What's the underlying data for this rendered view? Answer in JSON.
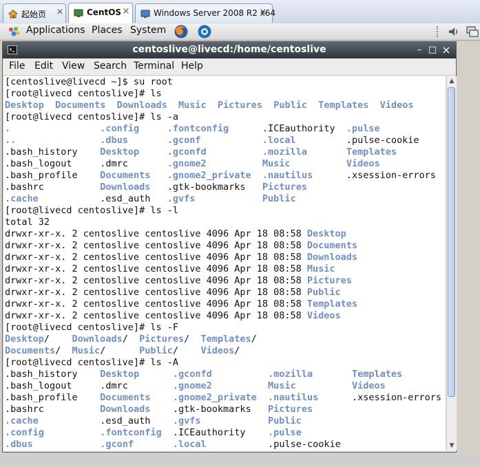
{
  "tabs": [
    {
      "label": "起始页",
      "icon": "home-icon",
      "active": false
    },
    {
      "label": "CentOS",
      "icon": "vm-icon",
      "active": true
    },
    {
      "label": "Windows Server 2008 R2 x64",
      "icon": "vm-icon",
      "active": false
    }
  ],
  "panel": {
    "applications": "Applications",
    "places": "Places",
    "system": "System"
  },
  "window": {
    "title": "centoslive@livecd:/home/centoslive",
    "minimize": "–",
    "maximize": "□",
    "close": "×"
  },
  "menu": {
    "file": "File",
    "edit": "Edit",
    "view": "View",
    "search": "Search",
    "terminal": "Terminal",
    "help": "Help"
  },
  "terminal": {
    "lines": [
      [
        [
          "n",
          "[centoslive@livecd ~]$ su root"
        ]
      ],
      [
        [
          "n",
          "[root@livecd centoslive]# ls"
        ]
      ],
      [
        [
          "d",
          "Desktop"
        ],
        [
          "n",
          "  "
        ],
        [
          "d",
          "Documents"
        ],
        [
          "n",
          "  "
        ],
        [
          "d",
          "Downloads"
        ],
        [
          "n",
          "  "
        ],
        [
          "d",
          "Music"
        ],
        [
          "n",
          "  "
        ],
        [
          "d",
          "Pictures"
        ],
        [
          "n",
          "  "
        ],
        [
          "d",
          "Public"
        ],
        [
          "n",
          "  "
        ],
        [
          "d",
          "Templates"
        ],
        [
          "n",
          "  "
        ],
        [
          "d",
          "Videos"
        ]
      ],
      [
        [
          "n",
          "[root@livecd centoslive]# ls -a"
        ]
      ],
      [
        [
          "d",
          "."
        ],
        [
          "n",
          "                "
        ],
        [
          "d",
          ".config"
        ],
        [
          "n",
          "     "
        ],
        [
          "d",
          ".fontconfig"
        ],
        [
          "n",
          "      "
        ],
        [
          "n",
          ".ICEauthority"
        ],
        [
          "n",
          "  "
        ],
        [
          "d",
          ".pulse"
        ]
      ],
      [
        [
          "d",
          ".."
        ],
        [
          "n",
          "               "
        ],
        [
          "d",
          ".dbus"
        ],
        [
          "n",
          "       "
        ],
        [
          "d",
          ".gconf"
        ],
        [
          "n",
          "           "
        ],
        [
          "d",
          ".local"
        ],
        [
          "n",
          "         "
        ],
        [
          "n",
          ".pulse-cookie"
        ]
      ],
      [
        [
          "n",
          ".bash_history"
        ],
        [
          "n",
          "    "
        ],
        [
          "d",
          "Desktop"
        ],
        [
          "n",
          "     "
        ],
        [
          "d",
          ".gconfd"
        ],
        [
          "n",
          "          "
        ],
        [
          "d",
          ".mozilla"
        ],
        [
          "n",
          "       "
        ],
        [
          "d",
          "Templates"
        ]
      ],
      [
        [
          "n",
          ".bash_logout"
        ],
        [
          "n",
          "     "
        ],
        [
          "n",
          ".dmrc"
        ],
        [
          "n",
          "       "
        ],
        [
          "d",
          ".gnome2"
        ],
        [
          "n",
          "          "
        ],
        [
          "d",
          "Music"
        ],
        [
          "n",
          "          "
        ],
        [
          "d",
          "Videos"
        ]
      ],
      [
        [
          "n",
          ".bash_profile"
        ],
        [
          "n",
          "    "
        ],
        [
          "d",
          "Documents"
        ],
        [
          "n",
          "   "
        ],
        [
          "d",
          ".gnome2_private"
        ],
        [
          "n",
          "  "
        ],
        [
          "d",
          ".nautilus"
        ],
        [
          "n",
          "      "
        ],
        [
          "n",
          ".xsession-errors"
        ]
      ],
      [
        [
          "n",
          ".bashrc"
        ],
        [
          "n",
          "          "
        ],
        [
          "d",
          "Downloads"
        ],
        [
          "n",
          "   "
        ],
        [
          "n",
          ".gtk-bookmarks"
        ],
        [
          "n",
          "   "
        ],
        [
          "d",
          "Pictures"
        ]
      ],
      [
        [
          "d",
          ".cache"
        ],
        [
          "n",
          "           "
        ],
        [
          "n",
          ".esd_auth"
        ],
        [
          "n",
          "   "
        ],
        [
          "d",
          ".gvfs"
        ],
        [
          "n",
          "            "
        ],
        [
          "d",
          "Public"
        ]
      ],
      [
        [
          "n",
          "[root@livecd centoslive]# ls -l"
        ]
      ],
      [
        [
          "n",
          "total 32"
        ]
      ],
      [
        [
          "n",
          "drwxr-xr-x. 2 centoslive centoslive 4096 Apr 18 08:58 "
        ],
        [
          "d",
          "Desktop"
        ]
      ],
      [
        [
          "n",
          "drwxr-xr-x. 2 centoslive centoslive 4096 Apr 18 08:58 "
        ],
        [
          "d",
          "Documents"
        ]
      ],
      [
        [
          "n",
          "drwxr-xr-x. 2 centoslive centoslive 4096 Apr 18 08:58 "
        ],
        [
          "d",
          "Downloads"
        ]
      ],
      [
        [
          "n",
          "drwxr-xr-x. 2 centoslive centoslive 4096 Apr 18 08:58 "
        ],
        [
          "d",
          "Music"
        ]
      ],
      [
        [
          "n",
          "drwxr-xr-x. 2 centoslive centoslive 4096 Apr 18 08:58 "
        ],
        [
          "d",
          "Pictures"
        ]
      ],
      [
        [
          "n",
          "drwxr-xr-x. 2 centoslive centoslive 4096 Apr 18 08:58 "
        ],
        [
          "d",
          "Public"
        ]
      ],
      [
        [
          "n",
          "drwxr-xr-x. 2 centoslive centoslive 4096 Apr 18 08:58 "
        ],
        [
          "d",
          "Templates"
        ]
      ],
      [
        [
          "n",
          "drwxr-xr-x. 2 centoslive centoslive 4096 Apr 18 08:58 "
        ],
        [
          "d",
          "Videos"
        ]
      ],
      [
        [
          "n",
          "[root@livecd centoslive]# ls -F"
        ]
      ],
      [
        [
          "d",
          "Desktop"
        ],
        [
          "n",
          "/    "
        ],
        [
          "d",
          "Downloads"
        ],
        [
          "n",
          "/  "
        ],
        [
          "d",
          "Pictures"
        ],
        [
          "n",
          "/  "
        ],
        [
          "d",
          "Templates"
        ],
        [
          "n",
          "/"
        ]
      ],
      [
        [
          "d",
          "Documents"
        ],
        [
          "n",
          "/  "
        ],
        [
          "d",
          "Music"
        ],
        [
          "n",
          "/      "
        ],
        [
          "d",
          "Public"
        ],
        [
          "n",
          "/    "
        ],
        [
          "d",
          "Videos"
        ],
        [
          "n",
          "/"
        ]
      ],
      [
        [
          "n",
          "[root@livecd centoslive]# ls -A"
        ]
      ],
      [
        [
          "n",
          ".bash_history"
        ],
        [
          "n",
          "    "
        ],
        [
          "d",
          "Desktop"
        ],
        [
          "n",
          "      "
        ],
        [
          "d",
          ".gconfd"
        ],
        [
          "n",
          "          "
        ],
        [
          "d",
          ".mozilla"
        ],
        [
          "n",
          "       "
        ],
        [
          "d",
          "Templates"
        ]
      ],
      [
        [
          "n",
          ".bash_logout"
        ],
        [
          "n",
          "     "
        ],
        [
          "n",
          ".dmrc"
        ],
        [
          "n",
          "        "
        ],
        [
          "d",
          ".gnome2"
        ],
        [
          "n",
          "          "
        ],
        [
          "d",
          "Music"
        ],
        [
          "n",
          "          "
        ],
        [
          "d",
          "Videos"
        ]
      ],
      [
        [
          "n",
          ".bash_profile"
        ],
        [
          "n",
          "    "
        ],
        [
          "d",
          "Documents"
        ],
        [
          "n",
          "    "
        ],
        [
          "d",
          ".gnome2_private"
        ],
        [
          "n",
          "  "
        ],
        [
          "d",
          ".nautilus"
        ],
        [
          "n",
          "      "
        ],
        [
          "n",
          ".xsession-errors"
        ]
      ],
      [
        [
          "n",
          ".bashrc"
        ],
        [
          "n",
          "          "
        ],
        [
          "d",
          "Downloads"
        ],
        [
          "n",
          "    "
        ],
        [
          "n",
          ".gtk-bookmarks"
        ],
        [
          "n",
          "   "
        ],
        [
          "d",
          "Pictures"
        ]
      ],
      [
        [
          "d",
          ".cache"
        ],
        [
          "n",
          "           "
        ],
        [
          "n",
          ".esd_auth"
        ],
        [
          "n",
          "    "
        ],
        [
          "d",
          ".gvfs"
        ],
        [
          "n",
          "            "
        ],
        [
          "d",
          "Public"
        ]
      ],
      [
        [
          "d",
          ".config"
        ],
        [
          "n",
          "          "
        ],
        [
          "d",
          ".fontconfig"
        ],
        [
          "n",
          "  "
        ],
        [
          "n",
          ".ICEauthority"
        ],
        [
          "n",
          "    "
        ],
        [
          "d",
          ".pulse"
        ]
      ],
      [
        [
          "d",
          ".dbus"
        ],
        [
          "n",
          "            "
        ],
        [
          "d",
          ".gconf"
        ],
        [
          "n",
          "       "
        ],
        [
          "d",
          ".local"
        ],
        [
          "n",
          "           "
        ],
        [
          "n",
          ".pulse-cookie"
        ]
      ]
    ]
  },
  "colors": {
    "directory": "#6f8fc8",
    "titlebar": "#3a4148",
    "scroll_thumb": "#b5c8e8"
  }
}
